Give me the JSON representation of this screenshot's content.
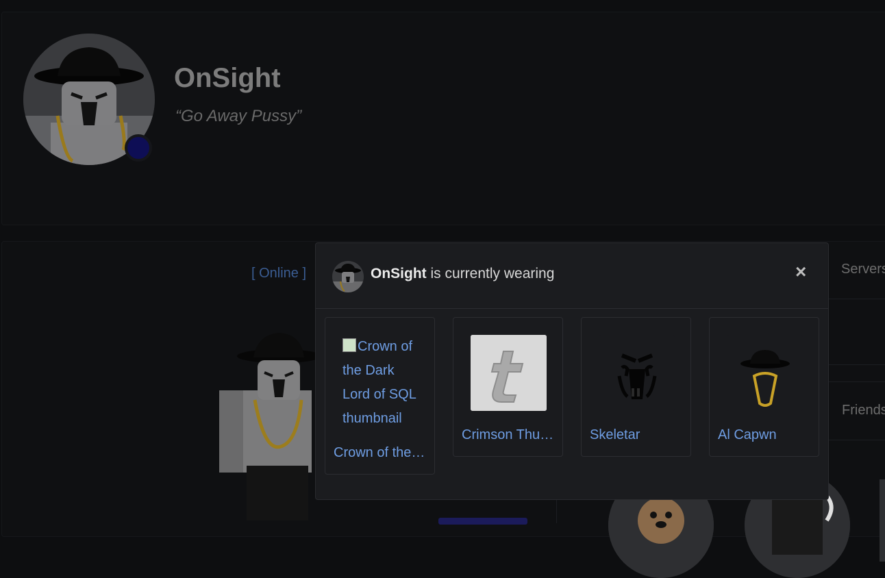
{
  "profile": {
    "username": "OnSight",
    "blurb": "“Go Away Pussy”",
    "presence_color": "#0e0e55"
  },
  "background_page": {
    "online_status": "[ Online ]",
    "servers_label": "Servers",
    "friends_label": "Friends"
  },
  "modal": {
    "username": "OnSight",
    "title_suffix": " is currently wearing",
    "close_icon": "×",
    "items": [
      {
        "name": "Crown of the Dark Lord of SQL",
        "alt": "Crown of the Dark Lord of SQL thumbnail",
        "thumb": "broken-image"
      },
      {
        "name": "Crimson Thunder",
        "thumb": "t-logo"
      },
      {
        "name": "Skeletar",
        "thumb": "skull-face"
      },
      {
        "name": "Al Capwn",
        "thumb": "hat-chain"
      }
    ]
  },
  "colors": {
    "link": "#6f9ee4",
    "modal_bg": "#1b1c1f",
    "page_bg": "#0d0e10"
  }
}
